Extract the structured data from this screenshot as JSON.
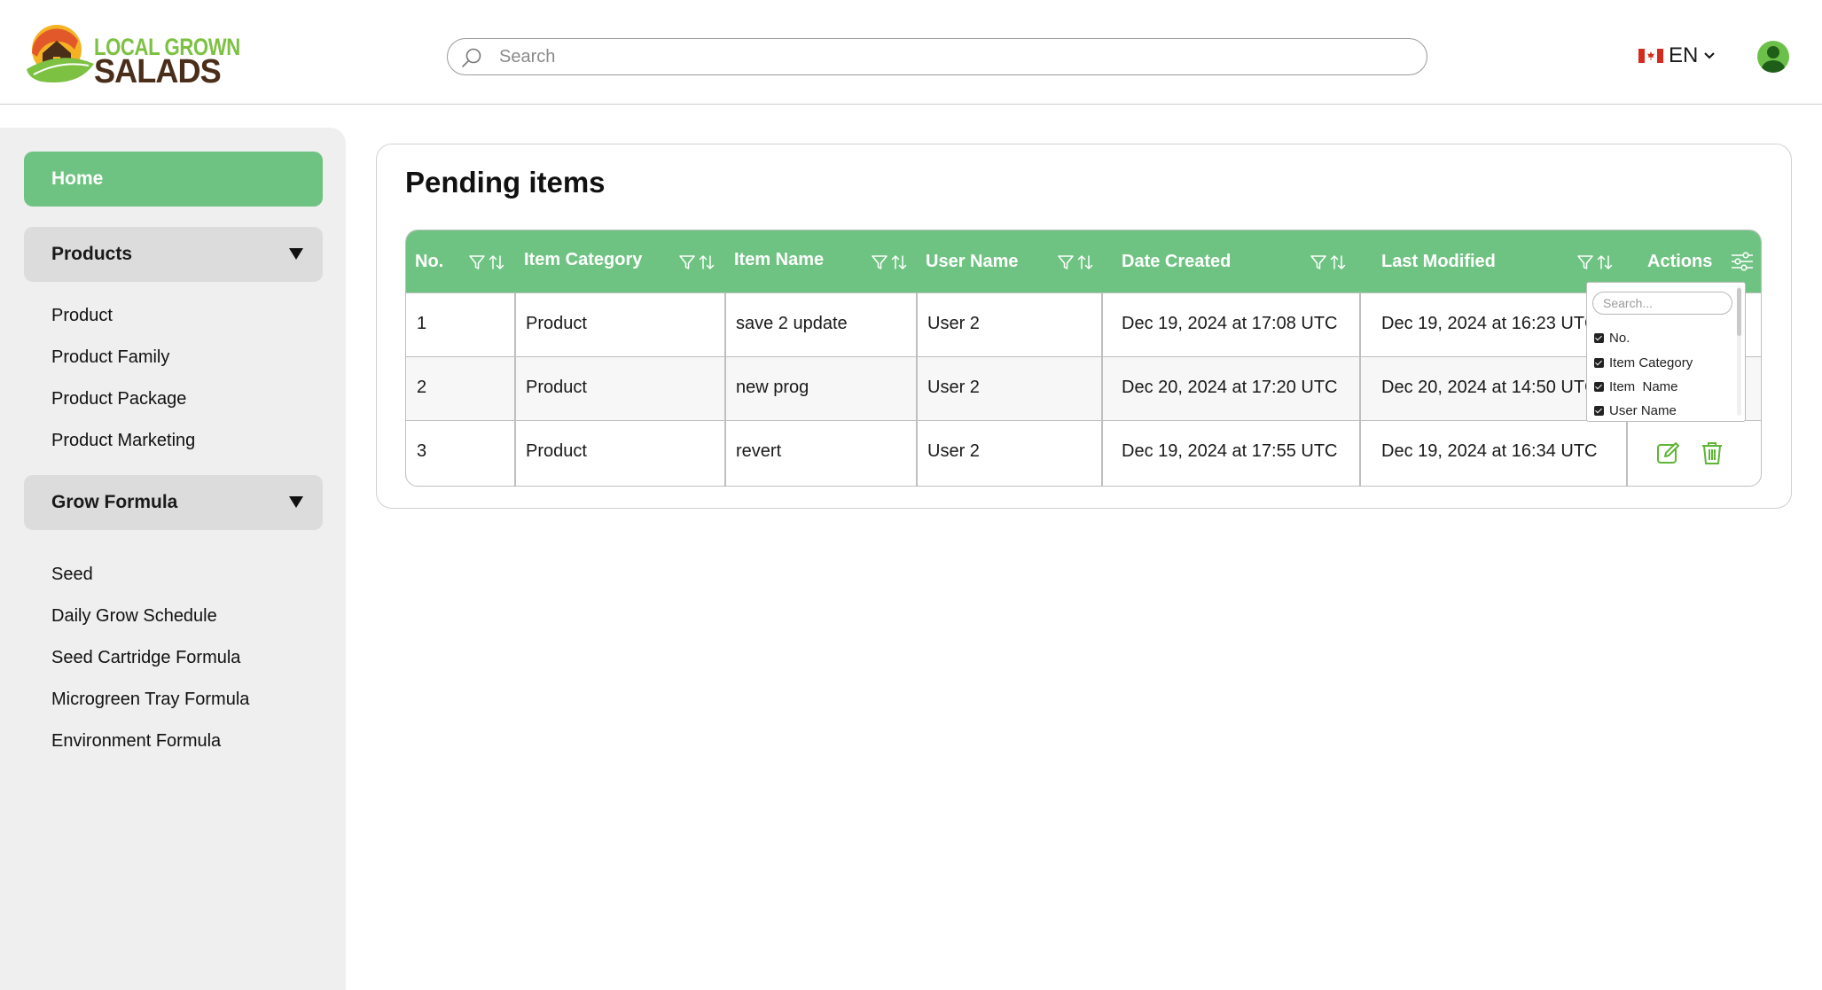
{
  "brand": {
    "line1": "LOCAL GROWN",
    "line2": "SALADS"
  },
  "header": {
    "search_placeholder": "Search",
    "language": "EN"
  },
  "sidebar": {
    "home": "Home",
    "products_group": "Products",
    "products_items": [
      "Product",
      "Product Family",
      "Product Package",
      "Product Marketing"
    ],
    "grow_group": "Grow Formula",
    "grow_items": [
      "Seed",
      "Daily Grow Schedule",
      "Seed Cartridge Formula",
      "Microgreen Tray Formula",
      "Environment Formula"
    ]
  },
  "main": {
    "title": "Pending items",
    "columns": [
      "No.",
      "Item Category",
      "Item Name",
      "User Name",
      "Date Created",
      "Last Modified",
      "Actions"
    ],
    "rows": [
      {
        "no": "1",
        "category": "Product",
        "name": "save 2 update",
        "user": "User 2",
        "created": "Dec 19, 2024 at 17:08 UTC",
        "modified": "Dec 19, 2024 at 16:23 UTC"
      },
      {
        "no": "2",
        "category": "Product",
        "name": "new prog",
        "user": "User 2",
        "created": "Dec 20, 2024 at 17:20 UTC",
        "modified": "Dec 20, 2024 at 14:50 UTC"
      },
      {
        "no": "3",
        "category": "Product",
        "name": "revert",
        "user": "User 2",
        "created": "Dec 19, 2024 at 17:55 UTC",
        "modified": "Dec 19, 2024 at 16:34 UTC"
      }
    ]
  },
  "column_picker": {
    "search_placeholder": "Search...",
    "options": [
      "No.",
      "Item Category",
      "Item  Name",
      "User Name"
    ]
  },
  "colors": {
    "accent": "#6fc382",
    "icon_green": "#5fb536",
    "sidebar_bg": "#efefef",
    "group_bg": "#dcdcdc"
  }
}
